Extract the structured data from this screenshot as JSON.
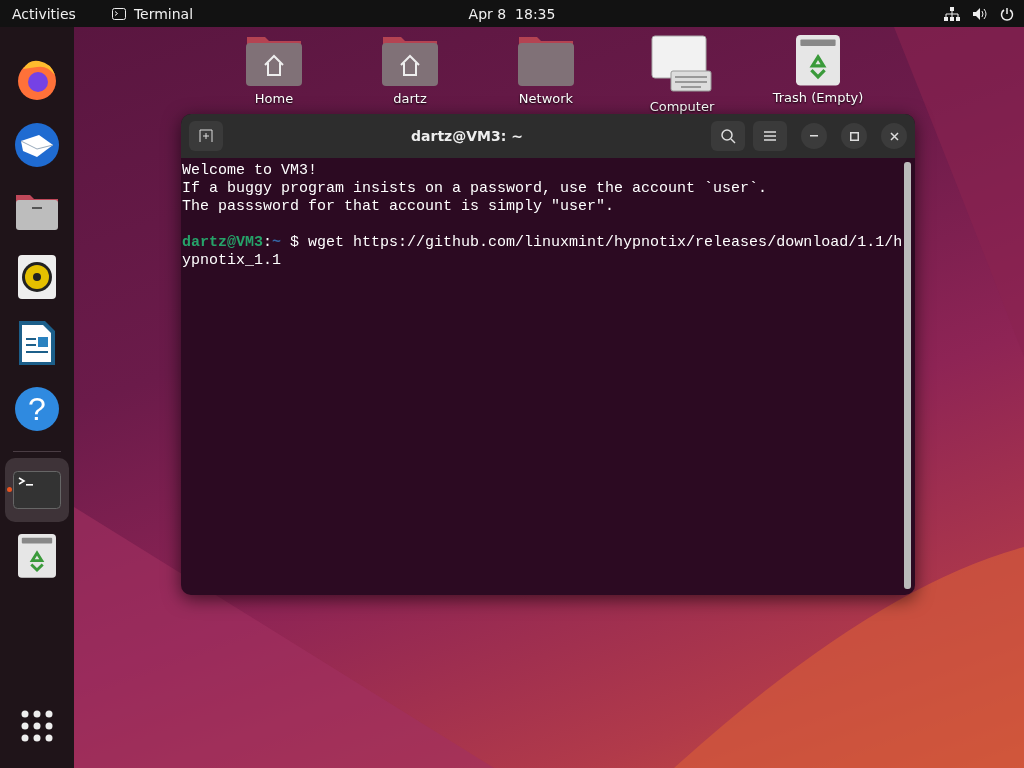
{
  "top_bar": {
    "activities": "Activities",
    "app_name": "Terminal",
    "clock": "Apr 8  18:35"
  },
  "dock": {
    "items": [
      {
        "kind": "browser",
        "selected": false,
        "running": false
      },
      {
        "kind": "mail",
        "selected": false,
        "running": false
      },
      {
        "kind": "files",
        "selected": false,
        "running": false
      },
      {
        "kind": "music",
        "selected": false,
        "running": false
      },
      {
        "kind": "writer",
        "selected": false,
        "running": false
      },
      {
        "kind": "help",
        "glyph": "?",
        "selected": false,
        "running": false
      },
      {
        "kind": "terminal",
        "selected": true,
        "running": true
      },
      {
        "kind": "trash",
        "selected": false,
        "running": false
      }
    ]
  },
  "desktop": {
    "icons": [
      {
        "kind": "home-folder",
        "label": "Home"
      },
      {
        "kind": "home-folder",
        "label": "dartz"
      },
      {
        "kind": "folder",
        "label": "Network"
      },
      {
        "kind": "computer",
        "label": "Computer"
      },
      {
        "kind": "trash",
        "label": "Trash (Empty)"
      }
    ]
  },
  "terminal": {
    "title": "dartz@VM3: ~",
    "lines": [
      "Welcome to VM3!",
      "If a buggy program insists on a password, use the account `user`.",
      "The passsword for that account is simply \"user\"."
    ],
    "prompt": {
      "user": "dartz@VM3",
      "separator": ":",
      "path": "~",
      "command": "$ wget https://github.com/linuxmint/hypnotix/releases/download/1.1/hypnotix_1.1"
    }
  }
}
